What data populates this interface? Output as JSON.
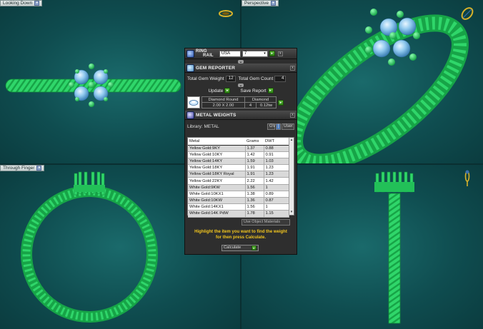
{
  "viewports": {
    "top_left": "Looking Down",
    "top_right": "Perspective",
    "bottom_left": "Through Finger",
    "bottom_right": ""
  },
  "ring_rail": {
    "title_line1": "RING",
    "title_line2": "RAIL",
    "country": "USA",
    "size": "7"
  },
  "gem_reporter": {
    "title": "GEM REPORTER",
    "total_gem_weight_label": "Total Gem Weight",
    "total_gem_weight": "12",
    "total_gem_count_label": "Total Gem Count",
    "total_gem_count": "4",
    "update_label": "Update",
    "save_report_label": "Save Report",
    "gem": {
      "name": "Diamond Round",
      "material": "Diamond",
      "size": "2.00 X 2.00",
      "count": "4",
      "weight": "0.12tw"
    }
  },
  "metal_weights": {
    "title": "METAL WEIGHTS",
    "library_label": "Library: METAL",
    "gv_label": "GV",
    "user_label": "User",
    "columns": [
      "Metal",
      "Grams",
      "DWT"
    ],
    "rows": [
      [
        "Yellow Gold:9KY",
        "1.37",
        "0.88"
      ],
      [
        "Yellow Gold:10KY",
        "1.42",
        "0.91"
      ],
      [
        "Yellow Gold:14KY",
        "1.59",
        "1.03"
      ],
      [
        "Yellow Gold:18KY",
        "1.91",
        "1.23"
      ],
      [
        "Yellow Gold:18KY Royal",
        "1.91",
        "1.23"
      ],
      [
        "Yellow Gold:22KY",
        "2.22",
        "1.42"
      ],
      [
        "White Gold:9KW",
        "1.56",
        "1"
      ],
      [
        "White Gold:10KX1",
        "1.38",
        "0.89"
      ],
      [
        "White Gold:10KW",
        "1.36",
        "0.87"
      ],
      [
        "White Gold:14KX1",
        "1.56",
        "1"
      ],
      [
        "White Gold:14K PdW",
        "1.78",
        "1.15"
      ]
    ],
    "use_object_materials": "Use Object Materials",
    "hint_line1": "Highlight the item you want to find the weight",
    "hint_line2": "for then press Calculate.",
    "calculate_label": "Calculate"
  }
}
